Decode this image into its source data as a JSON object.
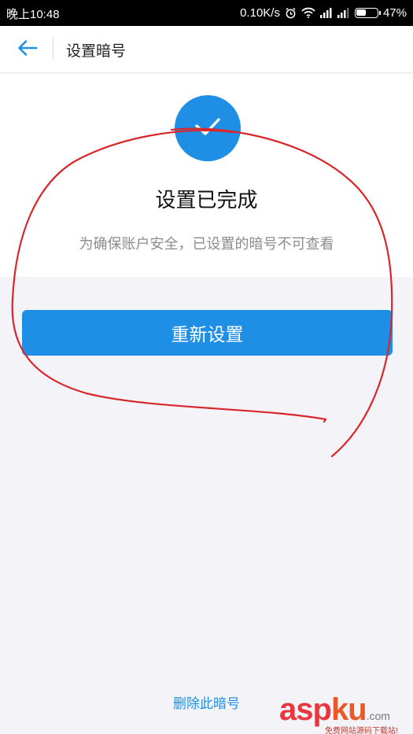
{
  "status_bar": {
    "time": "晚上10:48",
    "net_speed": "0.10K/s",
    "battery": "47%",
    "battery_level": 0.47,
    "icons": [
      "alarm-icon",
      "wifi-icon",
      "signal-icon",
      "signal-icon",
      "battery-icon"
    ]
  },
  "header": {
    "back_icon": "back-arrow-icon",
    "title": "设置暗号"
  },
  "main": {
    "success_icon": "checkmark-icon",
    "title": "设置已完成",
    "description": "为确保账户安全，已设置的暗号不可查看",
    "reset_button": "重新设置"
  },
  "footer": {
    "delete_link": "删除此暗号"
  },
  "watermark": {
    "brand_asp": "asp",
    "brand_ku": "ku",
    "brand_com": ".com",
    "tagline": "免费网站源码下载站!"
  },
  "colors": {
    "accent": "#1f8fe5",
    "annotation": "#d9262b",
    "background": "#f4f3f8"
  }
}
